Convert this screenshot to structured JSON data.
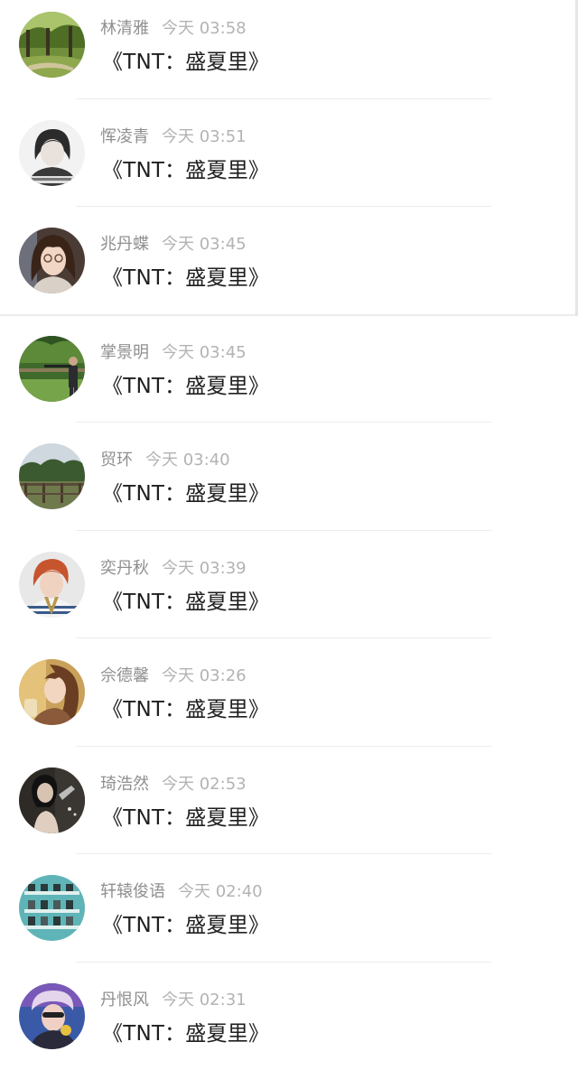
{
  "messages": [
    {
      "name": "林清雅",
      "time": "今天 03:58",
      "text": "《TNT：盛夏里》"
    },
    {
      "name": "恽凌青",
      "time": "今天 03:51",
      "text": "《TNT：盛夏里》"
    },
    {
      "name": "兆丹蝶",
      "time": "今天 03:45",
      "text": "《TNT：盛夏里》"
    },
    {
      "name": "掌景明",
      "time": "今天 03:45",
      "text": "《TNT：盛夏里》"
    },
    {
      "name": "贸环",
      "time": "今天 03:40",
      "text": "《TNT：盛夏里》"
    },
    {
      "name": "奕丹秋",
      "time": "今天 03:39",
      "text": "《TNT：盛夏里》"
    },
    {
      "name": "佘德馨",
      "time": "今天 03:26",
      "text": "《TNT：盛夏里》"
    },
    {
      "name": "琦浩然",
      "time": "今天 02:53",
      "text": "《TNT：盛夏里》"
    },
    {
      "name": "轩辕俊语",
      "time": "今天 02:40",
      "text": "《TNT：盛夏里》"
    },
    {
      "name": "丹恨风",
      "time": "今天 02:31",
      "text": "《TNT：盛夏里》"
    }
  ],
  "colors": {
    "name_text": "#8f8f8f",
    "time_text": "#b3b3b3",
    "message_text": "#1f1f1f",
    "divider": "#ececec",
    "background": "#ffffff"
  }
}
